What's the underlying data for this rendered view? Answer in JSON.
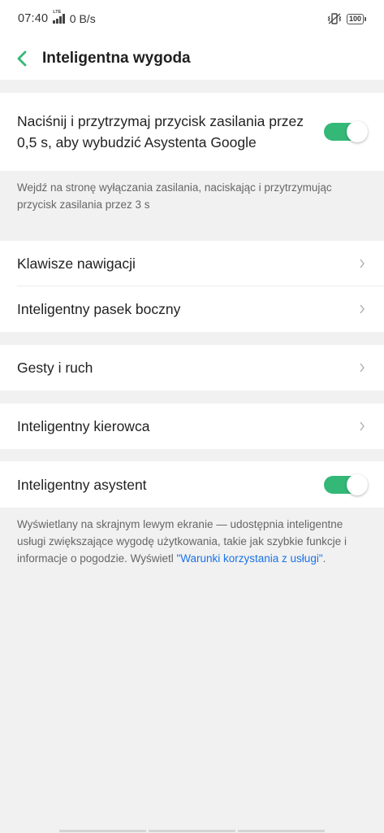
{
  "status_bar": {
    "time": "07:40",
    "network_type": "LTE",
    "net_speed": "0 B/s",
    "battery": "100"
  },
  "header": {
    "title": "Inteligentna wygoda"
  },
  "power_section": {
    "label": "Naciśnij i przytrzymaj przycisk zasilania przez 0,5 s, aby wybudzić Asystenta Google",
    "toggle_on": true,
    "description": "Wejdź na stronę wyłączania zasilania, naciskając i przytrzymując przycisk zasilania przez 3 s"
  },
  "menu_groups": [
    [
      "Klawisze nawigacji",
      "Inteligentny pasek boczny"
    ],
    [
      "Gesty i ruch"
    ],
    [
      "Inteligentny kierowca"
    ]
  ],
  "assistant_section": {
    "label": "Inteligentny asystent",
    "toggle_on": true,
    "description": "Wyświetlany na skrajnym lewym ekranie — udostępnia inteligentne usługi zwiększające wygodę użytkowania, takie jak szybkie funkcje i informacje o pogodzie. Wyświetl ",
    "link": "\"Warunki korzystania z usługi\"",
    "link_suffix": "."
  },
  "colors": {
    "accent": "#34b877",
    "link": "#1b73e8",
    "background": "#f1f1f1"
  }
}
